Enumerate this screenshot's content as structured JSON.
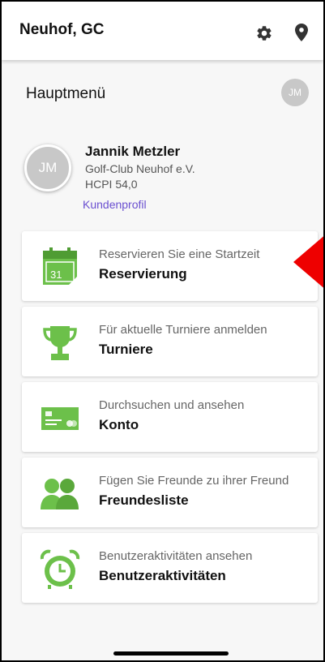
{
  "header": {
    "club_title": "Neuhof, GC",
    "settings_icon": "gear-icon",
    "location_icon": "location-pin-icon"
  },
  "main_menu": {
    "title": "Hauptmenü",
    "avatar_initials": "JM"
  },
  "profile": {
    "initials": "JM",
    "name": "Jannik Metzler",
    "club": "Golf-Club Neuhof e.V.",
    "handicap": "HCPI 54,0",
    "link_label": "Kundenprofil"
  },
  "menu_items": [
    {
      "subtitle": "Reservieren Sie eine Startzeit",
      "title": "Reservierung",
      "icon": "calendar-icon",
      "calendar_day": "31"
    },
    {
      "subtitle": "Für aktuelle Turniere anmelden",
      "title": "Turniere",
      "icon": "trophy-icon"
    },
    {
      "subtitle": "Durchsuchen und ansehen",
      "title": "Konto",
      "icon": "credit-card-icon"
    },
    {
      "subtitle": "Fügen Sie Freunde zu ihrer Freund",
      "title": "Freundesliste",
      "icon": "friends-icon"
    },
    {
      "subtitle": "Benutzeraktivitäten ansehen",
      "title": "Benutzeraktivitäten",
      "icon": "alarm-clock-icon"
    }
  ],
  "colors": {
    "accent_green": "#6cc04a",
    "link_purple": "#6a4fd0",
    "annotation_red": "#ee0000",
    "avatar_gray": "#c8c8c8"
  }
}
